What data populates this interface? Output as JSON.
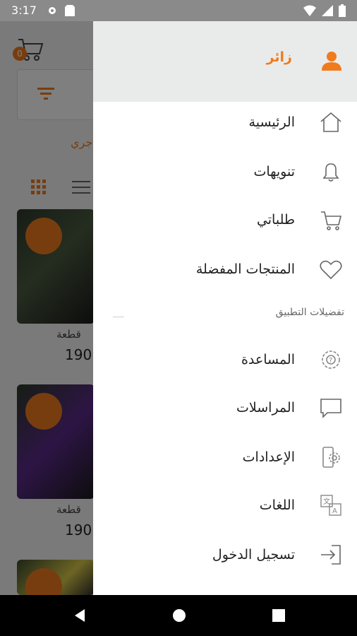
{
  "status_bar": {
    "time": "3:17"
  },
  "background": {
    "cart_badge": "0",
    "sort_text": "جري",
    "products": [
      {
        "caption": "قطعة",
        "price": "190."
      },
      {
        "caption": "قطعة",
        "price": "190."
      }
    ]
  },
  "drawer": {
    "user_label": "زائر",
    "menu": [
      {
        "label": "الرئيسية",
        "icon": "home-icon"
      },
      {
        "label": "تنويهات",
        "icon": "bell-icon"
      },
      {
        "label": "طلباتي",
        "icon": "cart-icon"
      },
      {
        "label": "المنتجات المفضلة",
        "icon": "heart-icon"
      }
    ],
    "section_title": "تفضيلات التطبيق",
    "settings": [
      {
        "label": "المساعدة",
        "icon": "help-gear-icon"
      },
      {
        "label": "المراسلات",
        "icon": "chat-icon"
      },
      {
        "label": "الإعدادات",
        "icon": "settings-icon"
      },
      {
        "label": "اللغات",
        "icon": "translate-icon"
      },
      {
        "label": "تسجيل الدخول",
        "icon": "login-icon"
      }
    ]
  },
  "colors": {
    "accent": "#f07a1e",
    "header_bg": "#e9ebea"
  }
}
